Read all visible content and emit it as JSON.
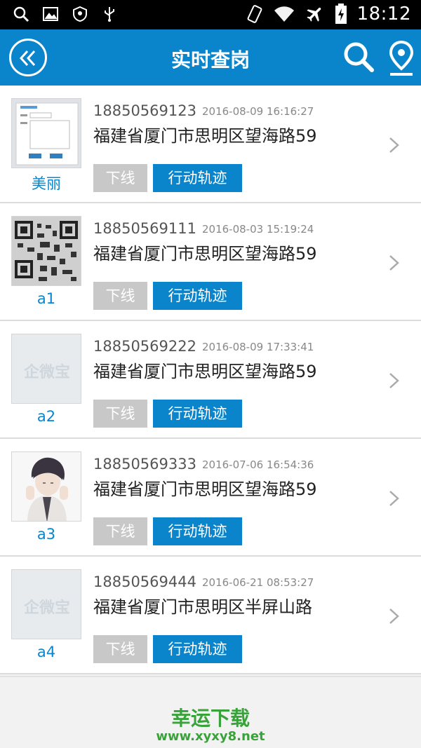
{
  "status_bar": {
    "time": "18:12"
  },
  "header": {
    "title": "实时查岗"
  },
  "records": [
    {
      "name": "美丽",
      "phone": "18850569123",
      "time": "2016-08-09 16:16:27",
      "address": "福建省厦门市思明区望海路59",
      "offline_label": "下线",
      "track_label": "行动轨迹"
    },
    {
      "name": "a1",
      "phone": "18850569111",
      "time": "2016-08-03 15:19:24",
      "address": "福建省厦门市思明区望海路59",
      "offline_label": "下线",
      "track_label": "行动轨迹"
    },
    {
      "name": "a2",
      "phone": "18850569222",
      "time": "2016-08-09 17:33:41",
      "address": "福建省厦门市思明区望海路59",
      "offline_label": "下线",
      "track_label": "行动轨迹"
    },
    {
      "name": "a3",
      "phone": "18850569333",
      "time": "2016-07-06 16:54:36",
      "address": "福建省厦门市思明区望海路59",
      "offline_label": "下线",
      "track_label": "行动轨迹"
    },
    {
      "name": "a4",
      "phone": "18850569444",
      "time": "2016-06-21 08:53:27",
      "address": "福建省厦门市思明区半屏山路",
      "offline_label": "下线",
      "track_label": "行动轨迹"
    }
  ],
  "placeholder_logo_text": "企微宝",
  "watermark": {
    "title": "幸运下载",
    "url": "www.xyxy8.net"
  },
  "colors": {
    "primary": "#0a85cc",
    "offline_button": "#c8c8c8",
    "watermark": "#3aa23a"
  },
  "icons": [
    "search-icon",
    "location-pin-icon",
    "double-chevron-left-icon",
    "chevron-right-icon"
  ]
}
